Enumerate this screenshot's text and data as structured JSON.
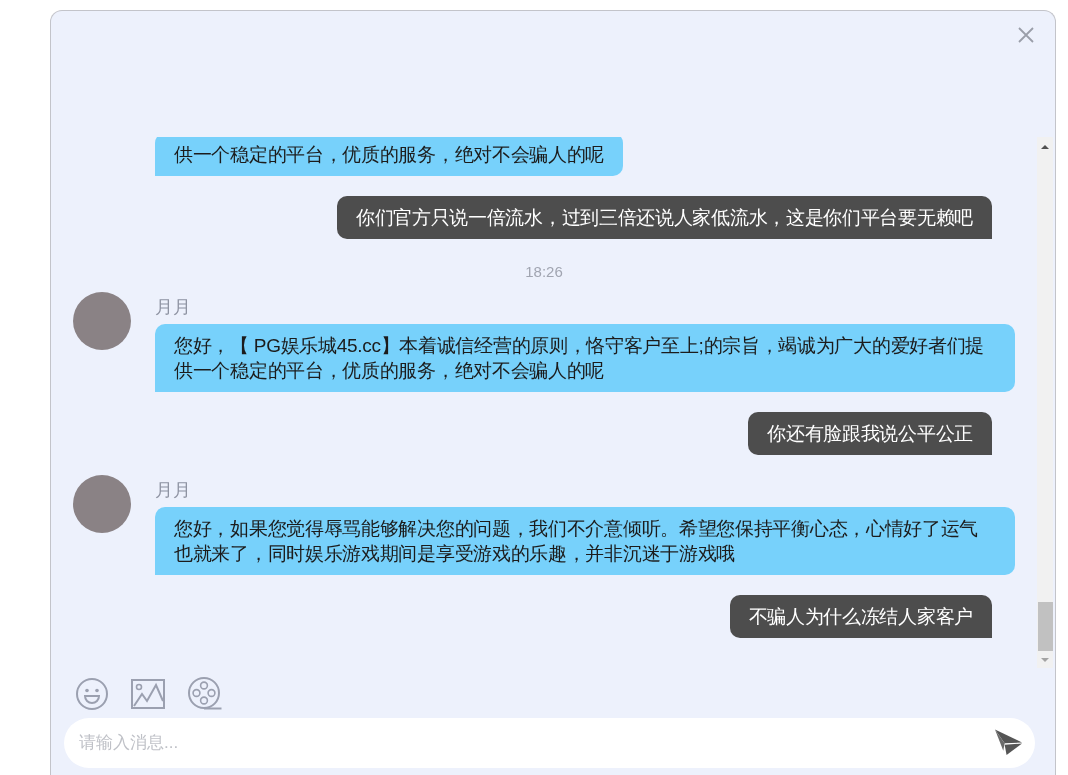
{
  "messages": [
    {
      "kind": "incoming",
      "text": "供一个稳定的平台，优质的服务，绝对不会骗人的呢"
    },
    {
      "kind": "outgoing",
      "text": "你们官方只说一倍流水，过到三倍还说人家低流水，这是你们平台要无赖吧"
    },
    {
      "kind": "time",
      "text": "18:26"
    },
    {
      "kind": "incoming",
      "sender": "月月",
      "text": "您好，【 PG娱乐城45.cc】本着诚信经营的原则，恪守客户至上;的宗旨，竭诚为广大的爱好者们提供一个稳定的平台，优质的服务，绝对不会骗人的呢"
    },
    {
      "kind": "outgoing",
      "text": "你还有脸跟我说公平公正"
    },
    {
      "kind": "incoming",
      "sender": "月月",
      "text": "您好，如果您觉得辱骂能够解决您的问题，我们不介意倾听。希望您保持平衡心态，心情好了运气也就来了，同时娱乐游戏期间是享受游戏的乐趣，并非沉迷于游戏哦"
    },
    {
      "kind": "outgoing",
      "text": "不骗人为什么冻结人家客户"
    }
  ],
  "composer": {
    "placeholder": "请输入消息..."
  }
}
